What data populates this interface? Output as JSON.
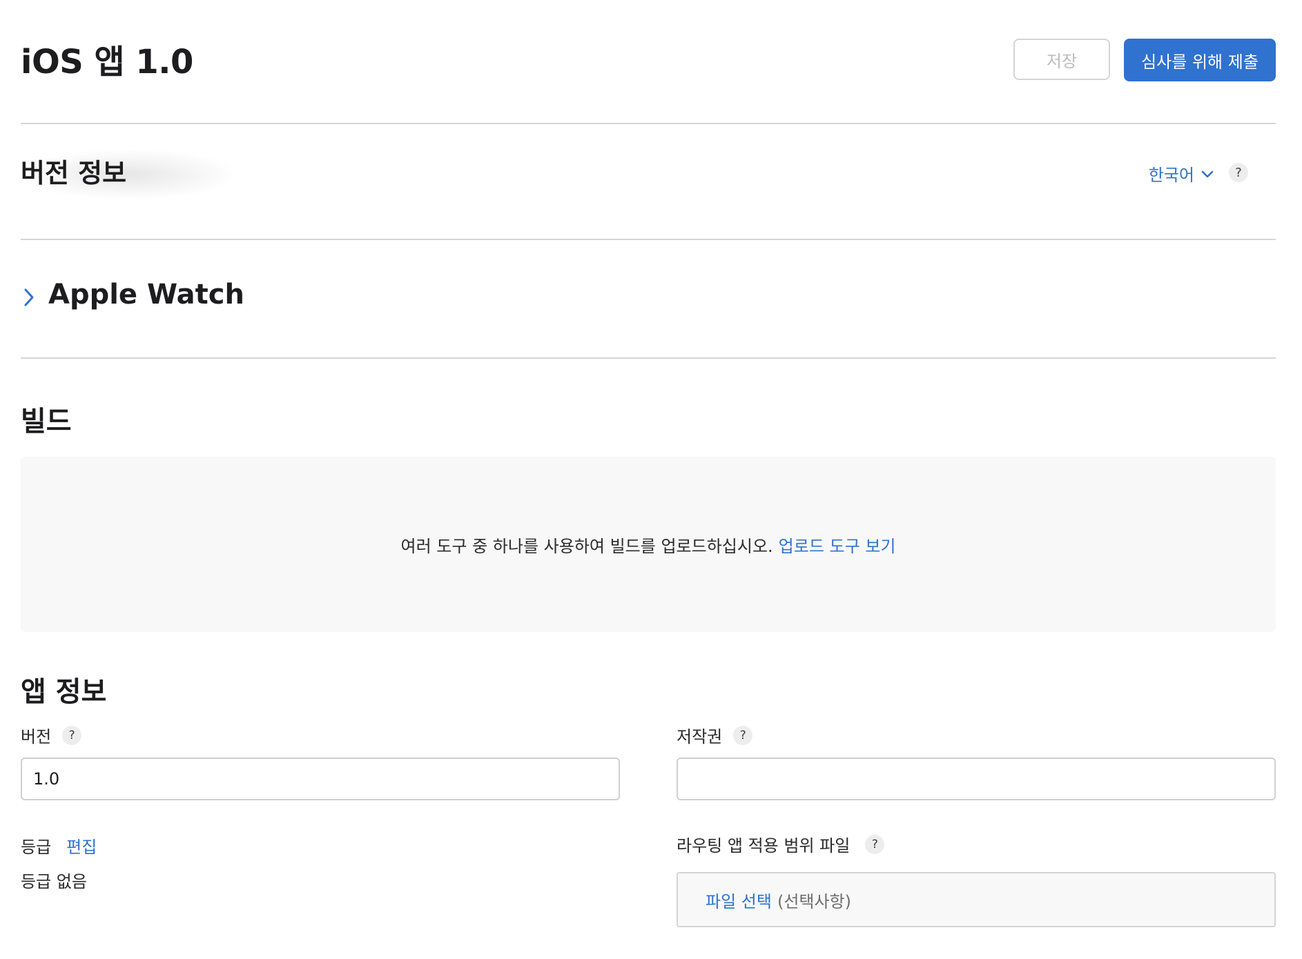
{
  "header": {
    "title": "iOS 앱 1.0",
    "save_label": "저장",
    "submit_label": "심사를 위해 제출"
  },
  "version_info": {
    "title": "버전 정보",
    "language": "한국어",
    "help": "?"
  },
  "apple_watch": {
    "title": "Apple Watch"
  },
  "build": {
    "title": "빌드",
    "message": "여러 도구 중 하나를 사용하여 빌드를 업로드하십시오.",
    "link": "업로드 도구 보기"
  },
  "app_info": {
    "title": "앱 정보",
    "version_label": "버전",
    "version_value": "1.0",
    "copyright_label": "저작권",
    "copyright_value": "",
    "rating_label": "등급",
    "rating_edit": "편집",
    "rating_value": "등급 없음",
    "routing_label": "라우팅 앱 적용 범위 파일",
    "file_choose": "파일 선택",
    "file_optional": "(선택사항)",
    "help": "?"
  },
  "colors": {
    "accent": "#2f72d0",
    "divider": "#d6d6d6",
    "panel_bg": "#f8f8f8"
  }
}
